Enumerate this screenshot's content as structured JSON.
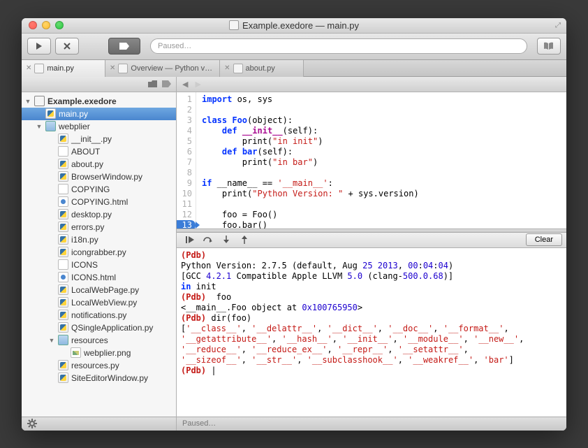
{
  "window": {
    "title": "Example.exedore — main.py"
  },
  "toolbar": {
    "search_placeholder": "Paused…"
  },
  "tabs": [
    {
      "label": "main.py",
      "active": true
    },
    {
      "label": "Overview — Python v…",
      "active": false
    },
    {
      "label": "about.py",
      "active": false
    }
  ],
  "sidebar": {
    "project": "Example.exedore",
    "items": [
      {
        "name": "main.py",
        "type": "py",
        "depth": 1,
        "selected": true
      },
      {
        "name": "webplier",
        "type": "folder",
        "depth": 1,
        "expanded": true
      },
      {
        "name": "__init__.py",
        "type": "py",
        "depth": 2
      },
      {
        "name": "ABOUT",
        "type": "txt",
        "depth": 2
      },
      {
        "name": "about.py",
        "type": "py",
        "depth": 2
      },
      {
        "name": "BrowserWindow.py",
        "type": "py",
        "depth": 2
      },
      {
        "name": "COPYING",
        "type": "txt",
        "depth": 2
      },
      {
        "name": "COPYING.html",
        "type": "html",
        "depth": 2
      },
      {
        "name": "desktop.py",
        "type": "py",
        "depth": 2
      },
      {
        "name": "errors.py",
        "type": "py",
        "depth": 2
      },
      {
        "name": "i18n.py",
        "type": "py",
        "depth": 2
      },
      {
        "name": "icongrabber.py",
        "type": "py",
        "depth": 2
      },
      {
        "name": "ICONS",
        "type": "txt",
        "depth": 2
      },
      {
        "name": "ICONS.html",
        "type": "html",
        "depth": 2
      },
      {
        "name": "LocalWebPage.py",
        "type": "py",
        "depth": 2
      },
      {
        "name": "LocalWebView.py",
        "type": "py",
        "depth": 2
      },
      {
        "name": "notifications.py",
        "type": "py",
        "depth": 2
      },
      {
        "name": "QSingleApplication.py",
        "type": "py",
        "depth": 2
      },
      {
        "name": "resources",
        "type": "folder",
        "depth": 2,
        "expanded": true
      },
      {
        "name": "webplier.png",
        "type": "img",
        "depth": 3
      },
      {
        "name": "resources.py",
        "type": "py",
        "depth": 2
      },
      {
        "name": "SiteEditorWindow.py",
        "type": "py",
        "depth": 2
      }
    ]
  },
  "editor": {
    "lines": 13,
    "breakpoint_line": 13,
    "code_tokens": [
      [
        [
          "kw",
          "import"
        ],
        [
          "nm",
          " os, sys"
        ]
      ],
      [],
      [
        [
          "kw",
          "class"
        ],
        [
          "nm",
          " "
        ],
        [
          "fn",
          "Foo"
        ],
        [
          "nm",
          "(object):"
        ]
      ],
      [
        [
          "nm",
          "    "
        ],
        [
          "kw",
          "def"
        ],
        [
          "nm",
          " "
        ],
        [
          "mag",
          "__init__"
        ],
        [
          "nm",
          "(self):"
        ]
      ],
      [
        [
          "nm",
          "        print("
        ],
        [
          "str",
          "\"in init\""
        ],
        [
          "nm",
          ")"
        ]
      ],
      [
        [
          "nm",
          "    "
        ],
        [
          "kw",
          "def"
        ],
        [
          "nm",
          " "
        ],
        [
          "fn",
          "bar"
        ],
        [
          "nm",
          "(self):"
        ]
      ],
      [
        [
          "nm",
          "        print("
        ],
        [
          "str",
          "\"in bar\""
        ],
        [
          "nm",
          ")"
        ]
      ],
      [],
      [
        [
          "kw",
          "if"
        ],
        [
          "nm",
          " __name__ == "
        ],
        [
          "str",
          "'__main__'"
        ],
        [
          "nm",
          ":"
        ]
      ],
      [
        [
          "nm",
          "    print("
        ],
        [
          "str",
          "\"Python Version: \""
        ],
        [
          "nm",
          " + sys.version)"
        ]
      ],
      [],
      [
        [
          "nm",
          "    foo = Foo()"
        ]
      ],
      [
        [
          "nm",
          "    foo.bar()"
        ]
      ]
    ]
  },
  "debug": {
    "clear_label": "Clear",
    "console_html": "<span class='pdb'>(Pdb)</span>\nPython Version: 2.7.5 (default, Aug <span class='cnum'>25</span> <span class='cnum'>2013</span>, <span class='cnum'>00</span>:<span class='cnum'>04</span>:<span class='cnum'>04</span>)\n[GCC <span class='cnum'>4.2.1</span> Compatible Apple LLVM <span class='cnum'>5.0</span> (clang-<span class='cnum'>500.0.68</span>)]\n<span class='ckw'>in</span> init\n<span class='pdb'>(Pdb)</span>  foo\n&lt;__main__.Foo object at <span class='cnum'>0x100765950</span>&gt;\n<span class='pdb'>(Pdb)</span> dir(foo)\n[<span class='cstr'>'__class__'</span>, <span class='cstr'>'__delattr__'</span>, <span class='cstr'>'__dict__'</span>, <span class='cstr'>'__doc__'</span>, <span class='cstr'>'__format__'</span>,\n<span class='cstr'>'__getattribute__'</span>, <span class='cstr'>'__hash__'</span>, <span class='cstr'>'__init__'</span>, <span class='cstr'>'__module__'</span>, <span class='cstr'>'__new__'</span>,\n<span class='cstr'>'__reduce__'</span>, <span class='cstr'>'__reduce_ex__'</span>, <span class='cstr'>'__repr__'</span>, <span class='cstr'>'__setattr__'</span>,\n<span class='cstr'>'__sizeof__'</span>, <span class='cstr'>'__str__'</span>, <span class='cstr'>'__subclasshook__'</span>, <span class='cstr'>'__weakref__'</span>, <span class='cstr'>'bar'</span>]\n<span class='pdb'>(Pdb)</span> |"
  },
  "status": {
    "text": "Paused…"
  }
}
